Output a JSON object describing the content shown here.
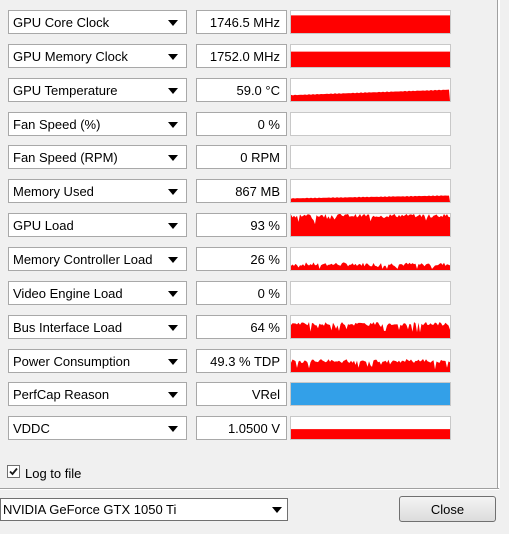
{
  "sensors": [
    {
      "name": "GPU Core Clock",
      "value": "1746.5 MHz",
      "graph": {
        "type": "fill",
        "level": 0.8,
        "color": "#ff0000"
      }
    },
    {
      "name": "GPU Memory Clock",
      "value": "1752.0 MHz",
      "graph": {
        "type": "fill",
        "level": 0.7,
        "color": "#ff0000"
      }
    },
    {
      "name": "GPU Temperature",
      "value": "59.0 °C",
      "graph": {
        "type": "ramp",
        "from": 0.25,
        "to": 0.5,
        "color": "#ff0000"
      }
    },
    {
      "name": "Fan Speed (%)",
      "value": "0 %",
      "graph": {
        "type": "empty",
        "color": "#ff0000"
      }
    },
    {
      "name": "Fan Speed (RPM)",
      "value": "0 RPM",
      "graph": {
        "type": "empty",
        "color": "#ff0000"
      }
    },
    {
      "name": "Memory Used",
      "value": "867 MB",
      "graph": {
        "type": "ramp",
        "from": 0.15,
        "to": 0.28,
        "color": "#ff0000"
      }
    },
    {
      "name": "GPU Load",
      "value": "93 %",
      "graph": {
        "type": "noisy",
        "level": 0.93,
        "color": "#ff0000"
      }
    },
    {
      "name": "Memory Controller Load",
      "value": "26 %",
      "graph": {
        "type": "noisy",
        "level": 0.26,
        "color": "#ff0000"
      }
    },
    {
      "name": "Video Engine Load",
      "value": "0 %",
      "graph": {
        "type": "empty",
        "color": "#ff0000"
      }
    },
    {
      "name": "Bus Interface Load",
      "value": "64 %",
      "graph": {
        "type": "noisy",
        "level": 0.64,
        "color": "#ff0000"
      }
    },
    {
      "name": "Power Consumption",
      "value": "49.3 % TDP",
      "graph": {
        "type": "noisy",
        "level": 0.5,
        "color": "#ff0000"
      }
    },
    {
      "name": "PerfCap Reason",
      "value": "VRel",
      "graph": {
        "type": "fill",
        "level": 1.0,
        "color": "#33a0e8"
      }
    },
    {
      "name": "VDDC",
      "value": "1.0500 V",
      "graph": {
        "type": "fill",
        "level": 0.45,
        "color": "#ff0000"
      }
    }
  ],
  "log_to_file": {
    "label": "Log to file",
    "checked": true
  },
  "gpu_select": {
    "selected": "NVIDIA GeForce GTX 1050 Ti"
  },
  "close_button": {
    "label": "Close"
  }
}
